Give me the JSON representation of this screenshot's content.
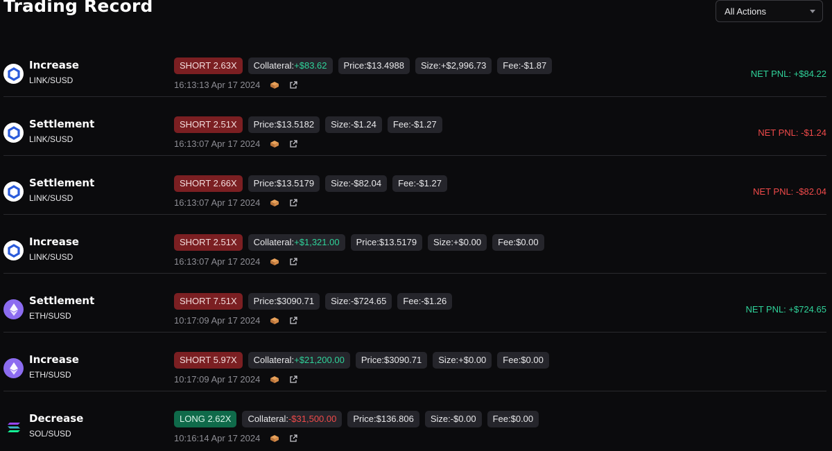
{
  "header": {
    "title": "Trading Record",
    "filter": {
      "selected": "All Actions"
    }
  },
  "colors": {
    "positive": "#2fd39a",
    "negative": "#f04a4a",
    "short_badge": "#7b1f22",
    "long_badge": "#0f6a4a"
  },
  "records": [
    {
      "action": "Increase",
      "pair": "LINK/SUSD",
      "coin_icon": "chainlink-icon",
      "position": "SHORT 2.63X",
      "collateral_label": "Collateral:",
      "collateral_value": "+$83.62",
      "price": "Price:$13.4988",
      "size": "Size:+$2,996.73",
      "fee": "Fee:-$1.87",
      "timestamp": "16:13:13 Apr 17 2024",
      "net_pnl": "NET PNL: +$84.22"
    },
    {
      "action": "Settlement",
      "pair": "LINK/SUSD",
      "coin_icon": "chainlink-icon",
      "position": "SHORT 2.51X",
      "price": "Price:$13.5182",
      "size": "Size:-$1.24",
      "fee": "Fee:-$1.27",
      "timestamp": "16:13:07 Apr 17 2024",
      "net_pnl": "NET PNL: -$1.24"
    },
    {
      "action": "Settlement",
      "pair": "LINK/SUSD",
      "coin_icon": "chainlink-icon",
      "position": "SHORT 2.66X",
      "price": "Price:$13.5179",
      "size": "Size:-$82.04",
      "fee": "Fee:-$1.27",
      "timestamp": "16:13:07 Apr 17 2024",
      "net_pnl": "NET PNL: -$82.04"
    },
    {
      "action": "Increase",
      "pair": "LINK/SUSD",
      "coin_icon": "chainlink-icon",
      "position": "SHORT 2.51X",
      "collateral_label": "Collateral:",
      "collateral_value": "+$1,321.00",
      "price": "Price:$13.5179",
      "size": "Size:+$0.00",
      "fee": "Fee:$0.00",
      "timestamp": "16:13:07 Apr 17 2024"
    },
    {
      "action": "Settlement",
      "pair": "ETH/SUSD",
      "coin_icon": "ethereum-icon",
      "position": "SHORT 7.51X",
      "price": "Price:$3090.71",
      "size": "Size:-$724.65",
      "fee": "Fee:-$1.26",
      "timestamp": "10:17:09 Apr 17 2024",
      "net_pnl": "NET PNL: +$724.65"
    },
    {
      "action": "Increase",
      "pair": "ETH/SUSD",
      "coin_icon": "ethereum-icon",
      "position": "SHORT 5.97X",
      "collateral_label": "Collateral:",
      "collateral_value": "+$21,200.00",
      "price": "Price:$3090.71",
      "size": "Size:+$0.00",
      "fee": "Fee:$0.00",
      "timestamp": "10:17:09 Apr 17 2024"
    },
    {
      "action": "Decrease",
      "pair": "SOL/SUSD",
      "coin_icon": "solana-icon",
      "position": "LONG 2.62X",
      "collateral_label": "Collateral:",
      "collateral_value": "-$31,500.00",
      "price": "Price:$136.806",
      "size": "Size:-$0.00",
      "fee": "Fee:$0.00",
      "timestamp": "10:16:14 Apr 17 2024"
    }
  ]
}
